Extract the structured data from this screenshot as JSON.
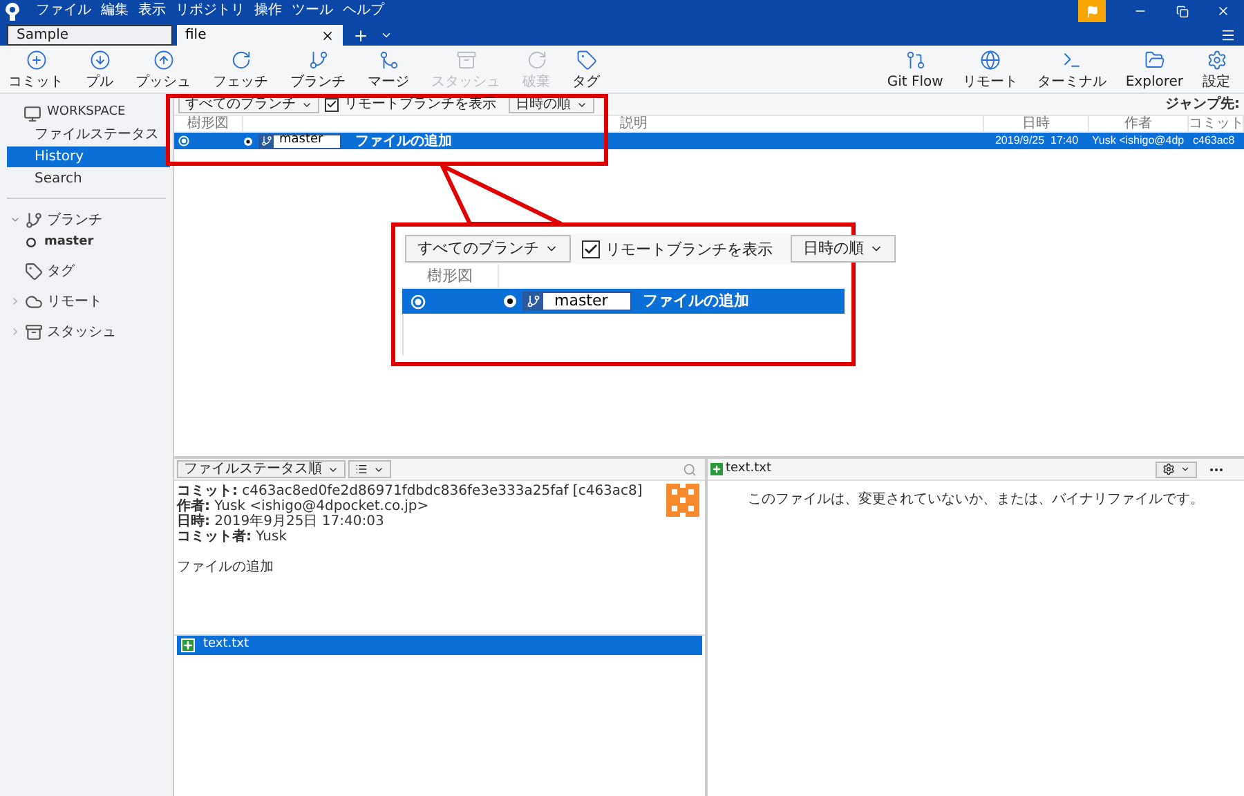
{
  "menu": [
    "ファイル",
    "編集",
    "表示",
    "リポジトリ",
    "操作",
    "ツール",
    "ヘルプ"
  ],
  "tabs": [
    {
      "label": "Sample",
      "selected": false
    },
    {
      "label": "file",
      "selected": true
    }
  ],
  "toolbar_left": [
    {
      "kind": "commit",
      "label": "コミット",
      "disabled": false
    },
    {
      "kind": "pull",
      "label": "プル",
      "disabled": false
    },
    {
      "kind": "push",
      "label": "プッシュ",
      "disabled": false
    },
    {
      "kind": "fetch",
      "label": "フェッチ",
      "disabled": false
    },
    {
      "kind": "branch",
      "label": "ブランチ",
      "disabled": false
    },
    {
      "kind": "merge",
      "label": "マージ",
      "disabled": false
    },
    {
      "kind": "stash",
      "label": "スタッシュ",
      "disabled": true
    },
    {
      "kind": "discard",
      "label": "破棄",
      "disabled": true
    },
    {
      "kind": "tag",
      "label": "タグ",
      "disabled": false
    }
  ],
  "toolbar_right": [
    {
      "kind": "gitflow",
      "label": "Git Flow"
    },
    {
      "kind": "remote",
      "label": "リモート"
    },
    {
      "kind": "terminal",
      "label": "ターミナル"
    },
    {
      "kind": "explorer",
      "label": "Explorer"
    },
    {
      "kind": "settings",
      "label": "設定"
    }
  ],
  "sidebar": {
    "workspace": {
      "label": "WORKSPACE",
      "items": [
        {
          "label": "ファイルステータス",
          "selected": false
        },
        {
          "label": "History",
          "selected": true
        },
        {
          "label": "Search",
          "selected": false
        }
      ]
    },
    "sections": [
      {
        "kind": "branch",
        "label": "ブランチ",
        "expanded": true,
        "children": [
          {
            "label": "master"
          }
        ]
      },
      {
        "kind": "tag",
        "label": "タグ"
      },
      {
        "kind": "remote",
        "label": "リモート",
        "expanded": false
      },
      {
        "kind": "stash",
        "label": "スタッシュ",
        "expanded": false
      }
    ]
  },
  "history": {
    "branch_filter": "すべてのブランチ",
    "show_remote": {
      "label": "リモートブランチを表示",
      "checked": true
    },
    "sort": "日時の順",
    "jump_label": "ジャンプ先:",
    "columns": [
      "樹形図",
      "説明",
      "日時",
      "作者",
      "コミット"
    ],
    "rows": [
      {
        "branch": "master",
        "description": "ファイルの追加",
        "date": "2019/9/25  17:40",
        "author": "Yusk <ishigo@4dp",
        "commit": "c463ac8",
        "selected": true
      }
    ]
  },
  "callout": {
    "branch_filter": "すべてのブランチ",
    "show_remote": {
      "label": "リモートブランチを表示",
      "checked": true
    },
    "sort": "日時の順",
    "column": "樹形図",
    "row": {
      "branch": "master",
      "description": "ファイルの追加",
      "selected": true
    }
  },
  "details": {
    "sort": "ファイルステータス順",
    "lines": [
      "**コミット:** c463ac8ed0fe2d86971fdbdc836fe3e333a25faf [c463ac8]",
      "**作者:** Yusk <ishigo@4dpocket.co.jp>",
      "**日時:** 2019年9月25日 17:40:03",
      "**コミット者:** Yusk"
    ],
    "message": "ファイルの追加",
    "files": [
      {
        "name": "text.txt",
        "selected": true
      }
    ]
  },
  "diff": {
    "file": "text.txt",
    "message": "このファイルは、変更されていないか、または、バイナリファイルです。"
  }
}
